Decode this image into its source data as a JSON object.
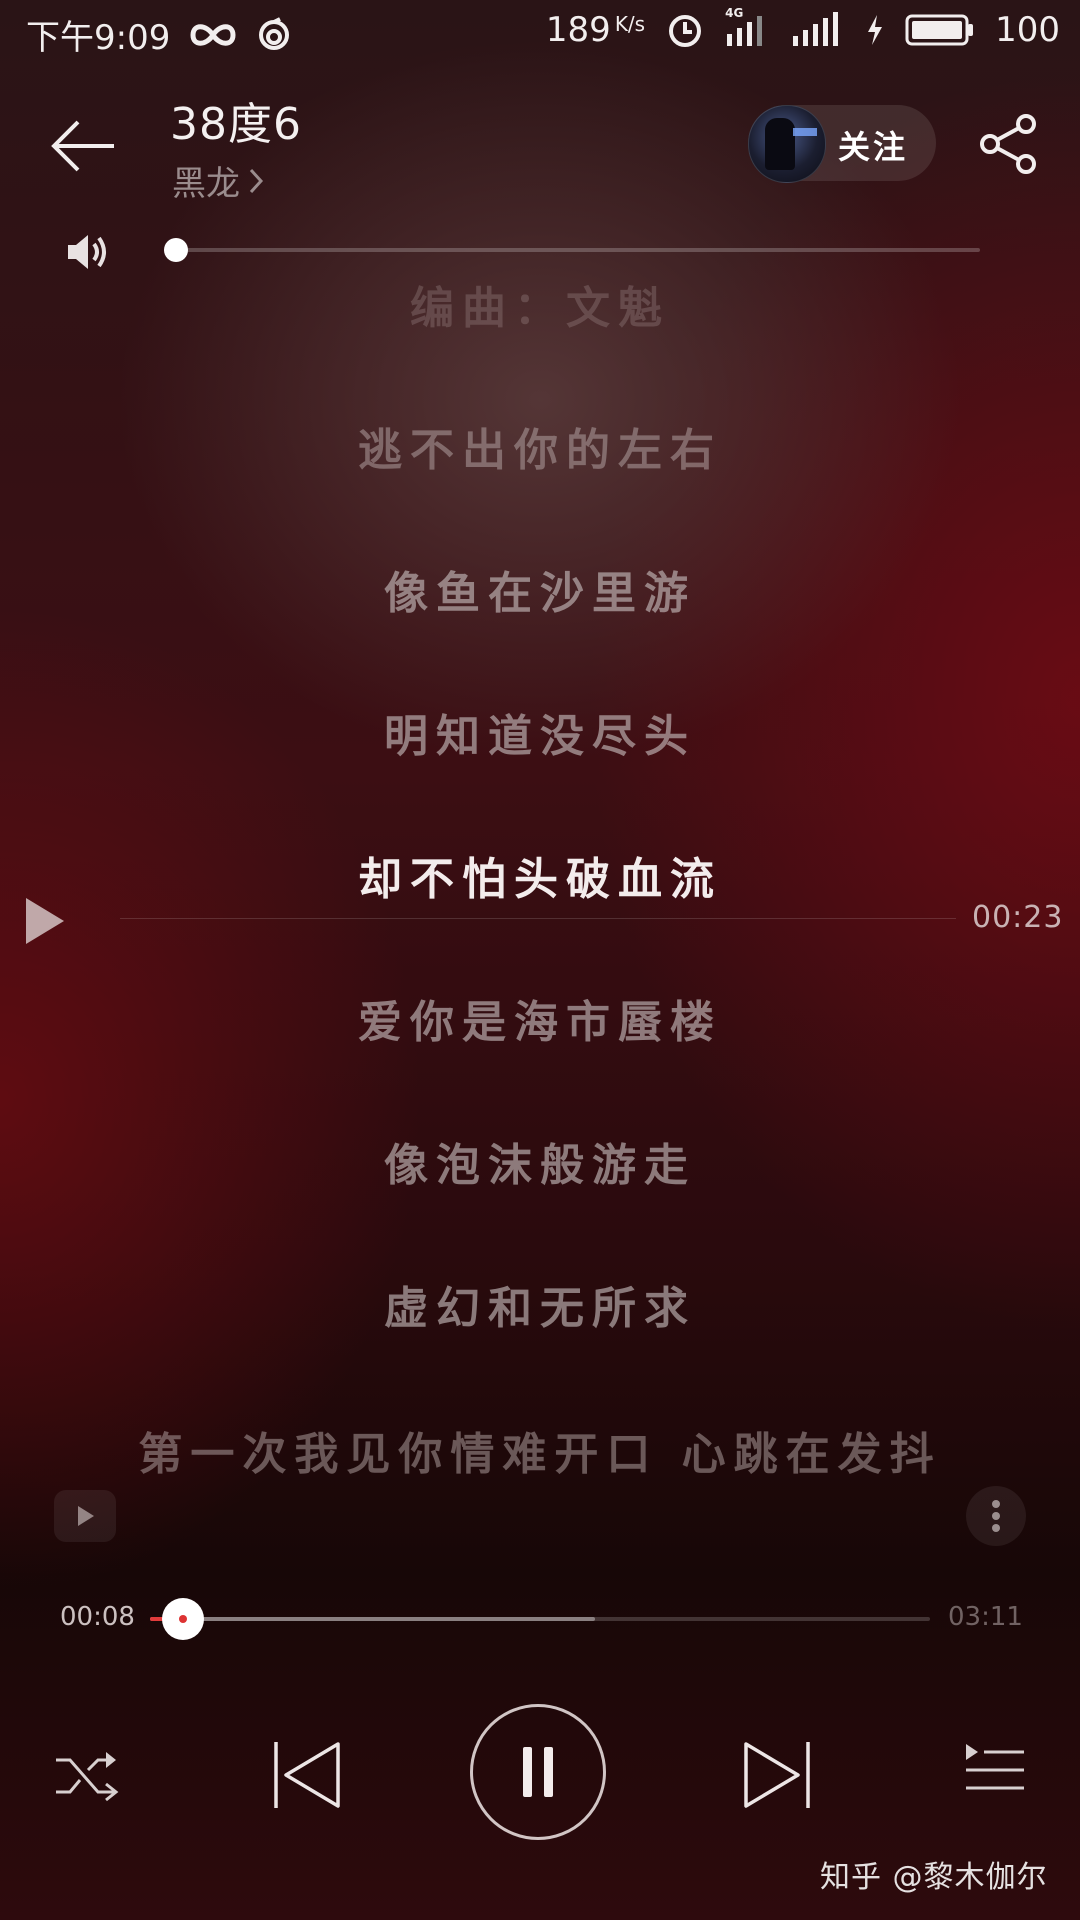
{
  "status_bar": {
    "time": "下午9:09",
    "speed_value": "189",
    "speed_unit": "K/s",
    "network": "4G",
    "battery": "100",
    "icons": [
      "infinity-icon",
      "sync-icon",
      "alarm-icon",
      "signal-icon",
      "charging-icon",
      "battery-icon"
    ]
  },
  "header": {
    "title": "38度6",
    "artist": "黑龙",
    "follow_label": "关注"
  },
  "volume": {
    "level": 0.0
  },
  "lyrics": {
    "lines": [
      "编曲：文魁",
      "逃不出你的左右",
      "像鱼在沙里游",
      "明知道没尽头",
      "却不怕头破血流",
      "爱你是海市蜃楼",
      "像泡沫般游走",
      "虚幻和无所求",
      "第一次我见你情难开口 心跳在发抖"
    ],
    "current_index": 4,
    "seek_time": "00:23"
  },
  "progress": {
    "current": "00:08",
    "total": "03:11",
    "played_fraction": 0.042,
    "buffered_fraction": 0.57
  },
  "watermark": "知乎 @黎木伽尔",
  "colors": {
    "accent": "#e23b3b",
    "background": "#3c0e13"
  }
}
